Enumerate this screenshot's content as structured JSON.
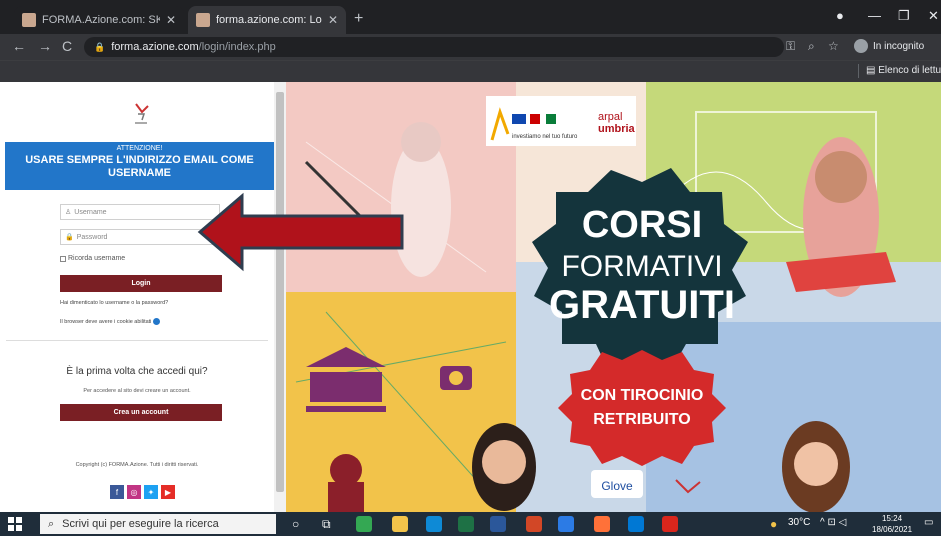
{
  "browser": {
    "tabs": [
      {
        "title": "FORMA.Azione.com: SKILLS CULT",
        "active": false
      },
      {
        "title": "forma.azione.com: Login al sito",
        "active": true
      }
    ],
    "url_host": "forma.azione.com",
    "url_path": "/login/index.php",
    "incognito_label": "In incognito",
    "reading_list_label": "Elenco di lettura"
  },
  "login": {
    "alert_title": "ATTENZIONE!",
    "alert_text": "USARE SEMPRE L'INDIRIZZO EMAIL COME USERNAME",
    "username_placeholder": "Username",
    "password_placeholder": "Password",
    "remember_label": "Ricorda username",
    "login_button": "Login",
    "forgot_text": "Hai dimenticato lo username o la password?",
    "cookies_text": "Il browser deve avere i cookie abilitati",
    "first_time_title": "È la prima volta che accedi qui?",
    "first_time_sub": "Per accedere al sito devi creare un account.",
    "create_account_button": "Crea un account",
    "copyright": "Copyright (c) FORMA.Azione. Tutti i diritti riservati."
  },
  "banner": {
    "headline_1": "CORSI",
    "headline_2": "FORMATIVI",
    "headline_3": "GRATUITI",
    "sub_1": "CON TIROCINIO",
    "sub_2": "RETRIBUITO",
    "tagline": "investiamo nel tuo futuro",
    "arpal_1": "arpal",
    "arpal_2": "umbria",
    "glove": "Glove"
  },
  "taskbar": {
    "search_placeholder": "Scrivi qui per eseguire la ricerca",
    "weather": "30°C",
    "time": "15:24",
    "date": "18/06/2021"
  },
  "colors": {
    "brand_red": "#7a1f24",
    "alert_blue": "#2276c9",
    "arrow_red": "#b0121b"
  }
}
